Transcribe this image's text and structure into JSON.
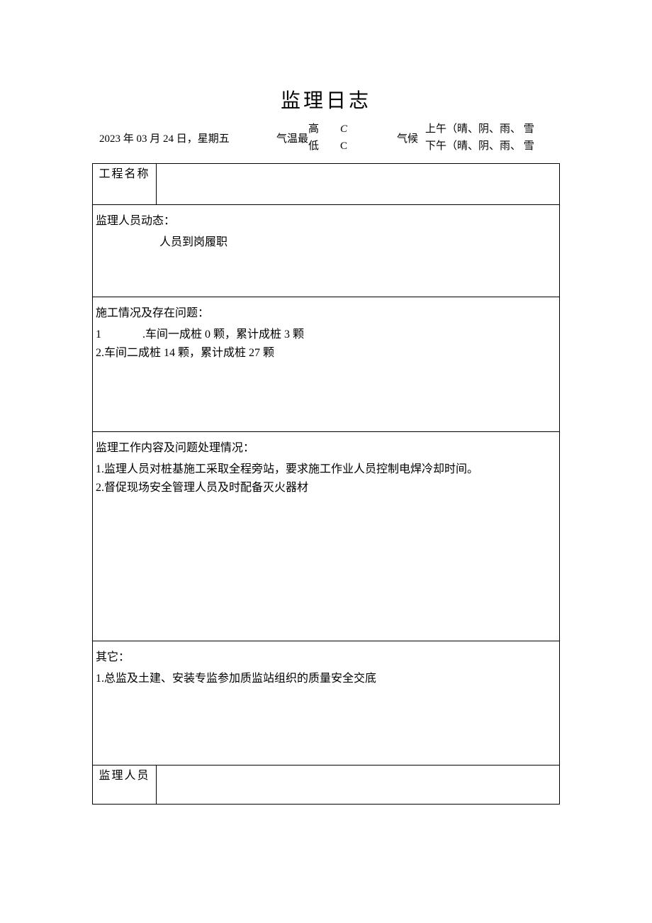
{
  "title": "监理日志",
  "header": {
    "date": "2023 年 03 月 24 日，星期五",
    "temp_label": "气温最",
    "temp_high_label": "高",
    "temp_high_unit": "C",
    "temp_low_label": "低",
    "temp_low_unit": "C",
    "weather_label": "气候",
    "weather_am": "上午（晴、阴、雨、 雪",
    "weather_pm": "下午（晴、阴、雨、 雪"
  },
  "rows": {
    "project_label": "工程名称",
    "project_value": "",
    "personnel_heading": "监理人员动态：",
    "personnel_line1": "人员到岗履职",
    "construction_heading": "施工情况及存在问题：",
    "construction_items": {
      "i1_num": "1",
      "i1_text": ".车间一成桩 0 颗，累计成桩 3 颗",
      "i2": "2.车间二成桩 14 颗，累计成桩 27 颗"
    },
    "supervision_heading": "监理工作内容及问题处理情况：",
    "supervision_items": {
      "i1": "1.监理人员对桩基施工采取全程旁站，要求施工作业人员控制电焊冷却时间。",
      "i2": "2.督促现场安全管理人员及时配备灭火器材"
    },
    "other_heading": "其它：",
    "other_items": {
      "i1": "1.总监及土建、安装专监参加质监站组织的质量安全交底"
    },
    "signer_label": "监理人员",
    "signer_value": ""
  }
}
